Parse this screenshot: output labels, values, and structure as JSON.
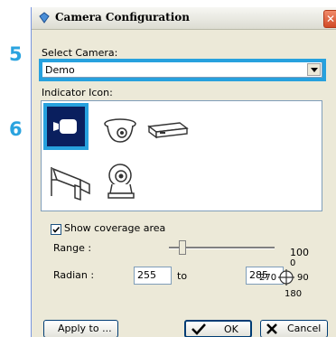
{
  "window": {
    "title": "Camera Configuration"
  },
  "steps": {
    "select_camera": "5",
    "indicator_icon": "6"
  },
  "select_camera": {
    "label": "Select Camera:",
    "value": "Demo"
  },
  "indicator": {
    "label": "Indicator Icon:",
    "icons": [
      "box-camera-icon",
      "dome-camera-icon",
      "flat-camera-icon",
      "bullet-camera-icon",
      "cube-camera-icon"
    ],
    "selected": "box-camera-icon"
  },
  "coverage": {
    "checkbox_label": "Show coverage area",
    "checked": true
  },
  "range": {
    "label": "Range :",
    "value": "100",
    "slider_fraction": 0.1
  },
  "radian": {
    "label": "Radian :",
    "from": "255",
    "to_label": "to",
    "to": "285",
    "compass": {
      "top": "0",
      "left": "270",
      "right": "90",
      "bottom": "180"
    }
  },
  "buttons": {
    "apply": "Apply to ...",
    "ok": "OK",
    "cancel": "Cancel"
  },
  "colors": {
    "highlight": "#27a1de",
    "step_number": "#2aa3df",
    "selected_bg": "#0a1f5e"
  }
}
